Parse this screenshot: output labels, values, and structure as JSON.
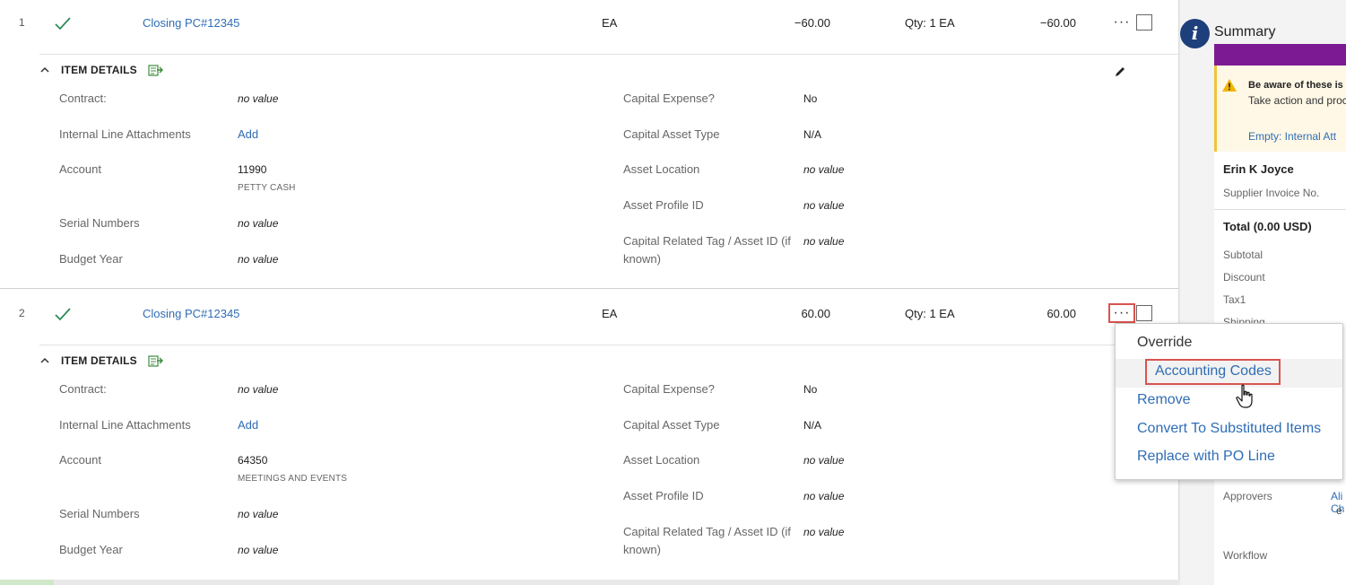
{
  "lines": [
    {
      "number": "1",
      "description": "Closing PC#12345",
      "uom": "EA",
      "unit_price": "−60.00",
      "quantity": "Qty: 1 EA",
      "total": "−60.00",
      "more": "···",
      "details_title": "ITEM DETAILS",
      "fields_left": [
        {
          "label": "Contract:",
          "value": "no value"
        },
        {
          "label": "Internal Line Attachments",
          "value": "Add"
        },
        {
          "label": "Account",
          "value": "11990",
          "sub": "PETTY CASH"
        },
        {
          "label": "Serial Numbers",
          "value": "no value"
        },
        {
          "label": "Budget Year",
          "value": "no value"
        }
      ],
      "fields_right": [
        {
          "label": "Capital Expense?",
          "value": "No"
        },
        {
          "label": "Capital Asset Type",
          "value": "N/A"
        },
        {
          "label": "Asset Location",
          "value": "no value"
        },
        {
          "label": "Asset Profile ID",
          "value": "no value"
        },
        {
          "label": "Capital Related Tag / Asset ID (if known)",
          "value": "no value"
        }
      ]
    },
    {
      "number": "2",
      "description": "Closing PC#12345",
      "uom": "EA",
      "unit_price": "60.00",
      "quantity": "Qty: 1 EA",
      "total": "60.00",
      "more": "···",
      "details_title": "ITEM DETAILS",
      "fields_left": [
        {
          "label": "Contract:",
          "value": "no value"
        },
        {
          "label": "Internal Line Attachments",
          "value": "Add"
        },
        {
          "label": "Account",
          "value": "64350",
          "sub": "MEETINGS AND EVENTS"
        },
        {
          "label": "Serial Numbers",
          "value": "no value"
        },
        {
          "label": "Budget Year",
          "value": "no value"
        }
      ],
      "fields_right": [
        {
          "label": "Capital Expense?",
          "value": "No"
        },
        {
          "label": "Capital Asset Type",
          "value": "N/A"
        },
        {
          "label": "Asset Location",
          "value": "no value"
        },
        {
          "label": "Asset Profile ID",
          "value": "no value"
        },
        {
          "label": "Capital Related Tag / Asset ID (if known)",
          "value": "no value"
        }
      ]
    }
  ],
  "summary": {
    "info_icon": "i",
    "title": "Summary",
    "warning_title": "Be aware of these is",
    "warning_sub": "Take action and proc",
    "warning_link": "Empty: Internal Att",
    "requester": "Erin K Joyce",
    "supplier_invoice_label": "Supplier Invoice No.",
    "total_label": "Total (0.00 USD)",
    "rows": [
      "Subtotal",
      "Discount",
      "Tax1",
      "Shipping"
    ],
    "approvers_label": "Approvers",
    "approvers_link": "Ali Ch",
    "workflow_label": "Workflow",
    "edge_char": "e"
  },
  "menu": {
    "items": [
      "Override",
      "Accounting Codes",
      "Remove",
      "Convert To Substituted Items",
      "Replace with PO Line"
    ]
  },
  "colors": {
    "link": "#2f6db5",
    "purple": "#7c1a94",
    "highlight_box": "#d9534f",
    "check": "#2e8b57",
    "info_blue": "#1d3f7c"
  }
}
